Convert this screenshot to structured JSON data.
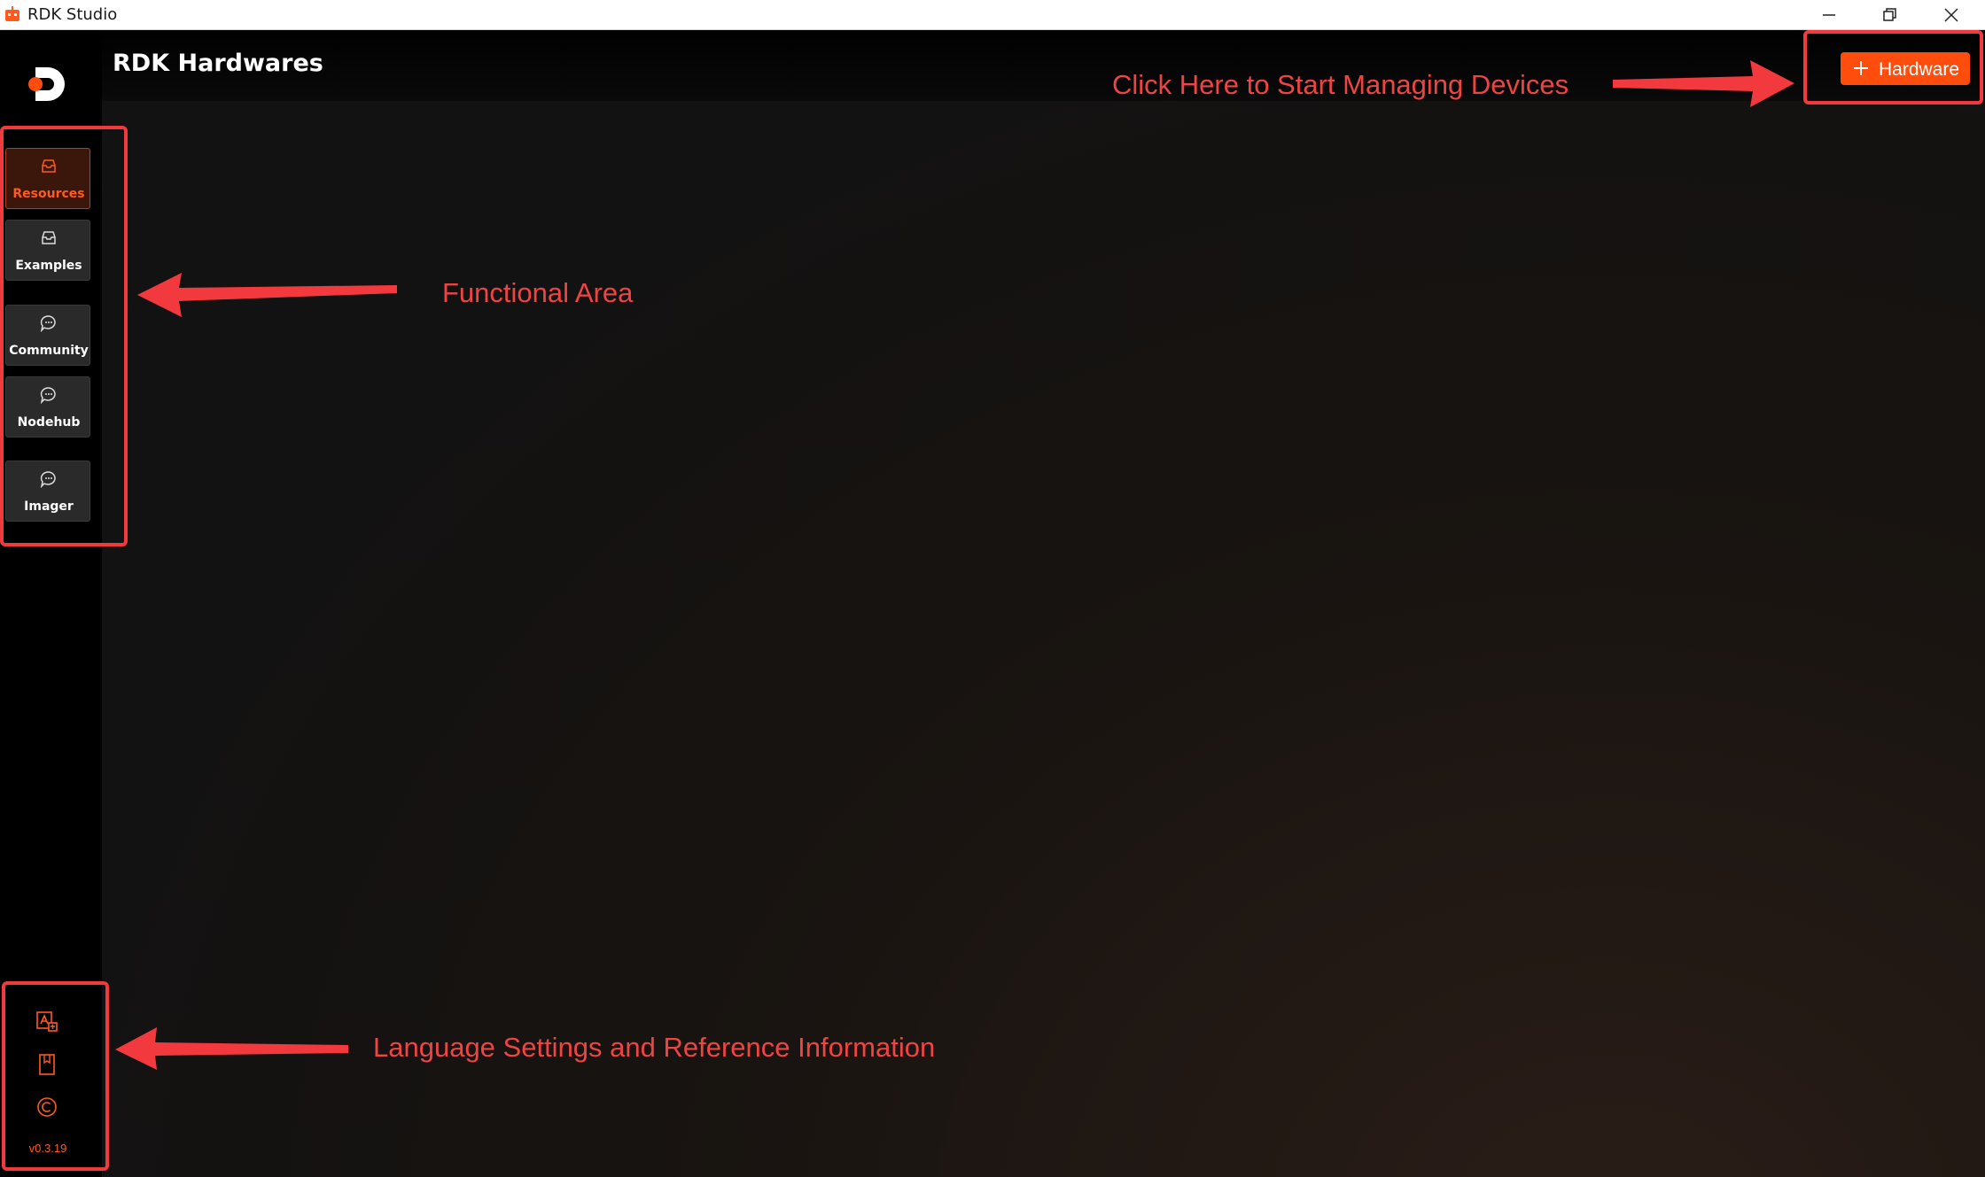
{
  "window": {
    "title": "RDK Studio",
    "controls": [
      "minimize-icon",
      "restore-icon",
      "close-icon"
    ]
  },
  "header": {
    "page_title": "RDK Hardwares",
    "hardware_button_label": "Hardware"
  },
  "sidebar": {
    "items": [
      {
        "label": "Resources",
        "icon": "inbox-icon",
        "active": true
      },
      {
        "label": "Examples",
        "icon": "inbox-icon",
        "active": false
      },
      {
        "label": "Community",
        "icon": "chat-icon",
        "active": false
      },
      {
        "label": "Nodehub",
        "icon": "chat-icon",
        "active": false
      },
      {
        "label": "Imager",
        "icon": "chat-icon",
        "active": false
      }
    ],
    "utilities": [
      "language-icon",
      "book-icon",
      "copyright-icon"
    ],
    "version": "v0.3.19"
  },
  "annotations": {
    "functional_area": "Functional Area",
    "start_managing": "Click Here to Start Managing Devices",
    "language_settings": "Language Settings and Reference Information"
  },
  "colors": {
    "accent": "#ff4d0e",
    "annotation": "#f23a3e",
    "sidebar_bg": "#000000",
    "active_item_bg": "#3a160b"
  }
}
